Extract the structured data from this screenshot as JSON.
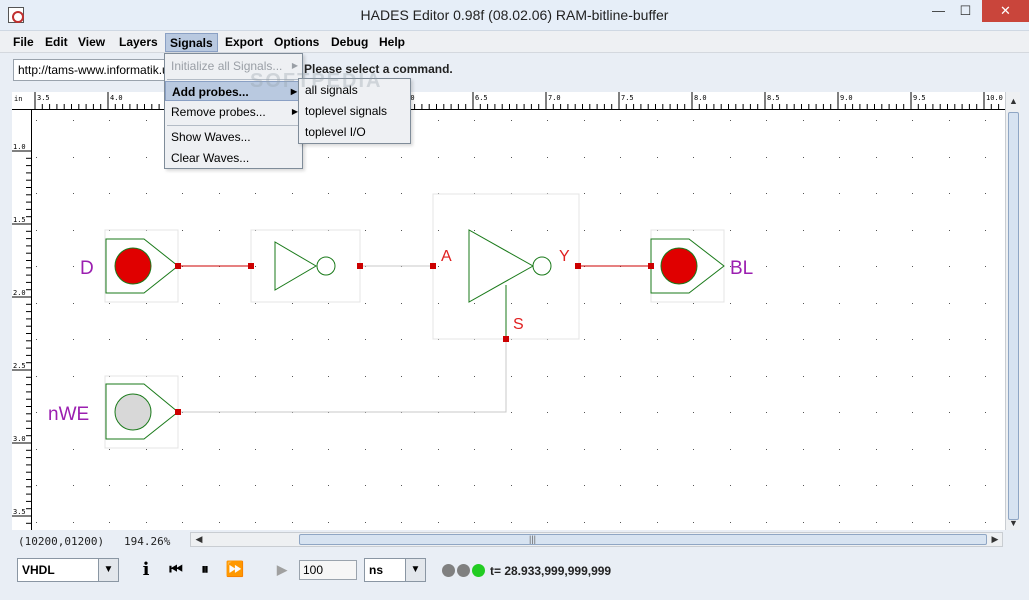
{
  "window": {
    "title": "HADES Editor 0.98f (08.02.06)   RAM-bitline-buffer",
    "minimize_glyph": "—",
    "maximize_glyph": "☐",
    "close_glyph": "✕"
  },
  "menubar": [
    "File",
    "Edit",
    "View",
    "Layers",
    "Signals",
    "Export",
    "Options",
    "Debug",
    "Help"
  ],
  "active_menu": "Signals",
  "signals_menu": {
    "items": [
      {
        "label": "Initialize all Signals...",
        "enabled": false,
        "submenu": true
      },
      {
        "label": "Add probes...",
        "highlighted": true,
        "submenu": true
      },
      {
        "label": "Remove probes...",
        "submenu": true
      },
      {
        "label": "Show Waves..."
      },
      {
        "label": "Clear Waves..."
      }
    ]
  },
  "add_probes_submenu": [
    "all signals",
    "toplevel signals",
    "toplevel I/O"
  ],
  "command_bar": {
    "url": "http://tams-www.informatik.uni-hamburg.de",
    "message": "Please select a command."
  },
  "watermark": "SOFTPEDIA",
  "ruler": {
    "unit": "in",
    "top_labels": [
      "3.5",
      "4.0",
      "4.5",
      "5.0",
      "5.5",
      "6.0",
      "6.5",
      "7.0",
      "7.5",
      "8.0",
      "8.5",
      "9.0",
      "9.5",
      "10.0"
    ],
    "left_labels": [
      "1.0",
      "1.5",
      "2.0",
      "2.5",
      "3.0",
      "3.5"
    ]
  },
  "circuit": {
    "input_d": "D",
    "input_nwe": "nWE",
    "output_bl": "BL",
    "tristate_pin_a": "A",
    "tristate_pin_y": "Y",
    "tristate_pin_s": "S",
    "colors": {
      "wire_active": "#cc0000",
      "wire_idle": "#c8c8c8",
      "gate": "#1a7a1a",
      "label": "#9b1fb0",
      "pin_label": "#e02020",
      "led_on": "#e00000",
      "led_off": "#d8d8d8"
    }
  },
  "status": {
    "coords": "(10200,01200)",
    "zoom": "194.26%"
  },
  "toolbar": {
    "language": "VHDL",
    "step_value": "100",
    "time_unit": "ns",
    "sim_time": "t= 28.933,999,999,999",
    "info_glyph": "i",
    "rewind_glyph": "⏮",
    "pause_glyph": "⏸",
    "fastfwd_glyph": "⏩",
    "play_glyph": "▶",
    "dropdown_glyph": "▼",
    "led_colors": [
      "#808080",
      "#808080",
      "#22cc22"
    ]
  }
}
